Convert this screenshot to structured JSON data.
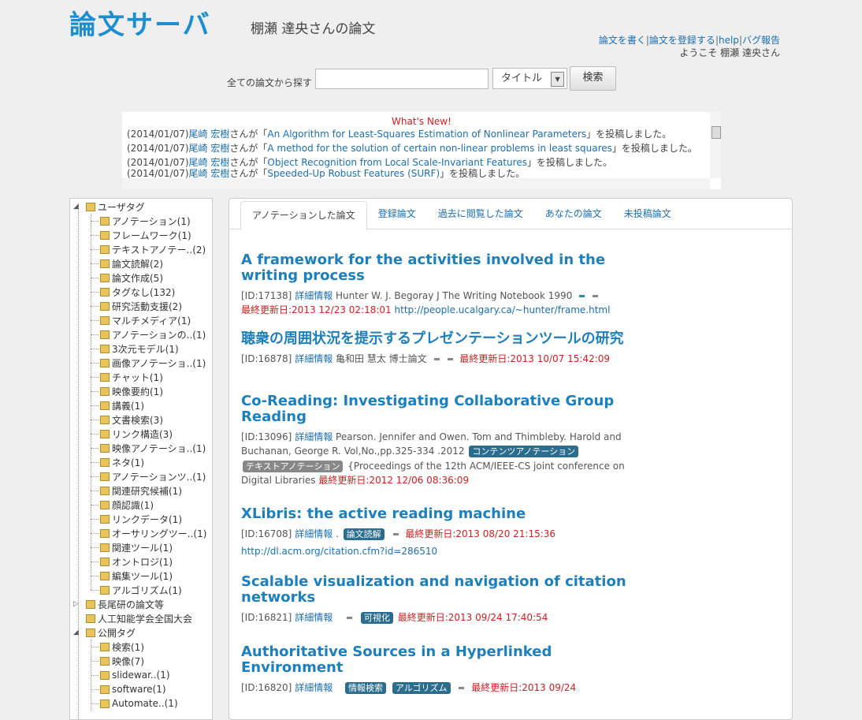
{
  "header": {
    "site_title": "論文サーバ",
    "user_heading": "棚瀬 達央さんの論文",
    "links": [
      "論文を書く",
      "論文を登録する",
      "help",
      "バグ報告"
    ],
    "welcome": "ようこそ 棚瀬 達央さん"
  },
  "search": {
    "label": "全ての論文から探す",
    "value": "",
    "field_selected": "タイトル",
    "button": "検索"
  },
  "news": {
    "title": "What's New!",
    "items": [
      {
        "date": "(2014/01/07)",
        "user": "尾崎 宏樹",
        "mid": "さんが「",
        "paper": "An Algorithm for Least-Squares Estimation of Nonlinear Parameters",
        "end": "」を投稿しました。"
      },
      {
        "date": "(2014/01/07)",
        "user": "尾崎 宏樹",
        "mid": "さんが「",
        "paper": "A method for the solution of certain non-linear problems in least squares",
        "end": "」を投稿しました。"
      },
      {
        "date": "(2014/01/07)",
        "user": "尾崎 宏樹",
        "mid": "さんが「",
        "paper": "Object Recognition from Local Scale-Invariant Features",
        "end": "」を投稿しました。"
      },
      {
        "date": "(2014/01/07)",
        "user": "尾崎 宏樹",
        "mid": "さんが「",
        "paper": "Speeded-Up Robust Features (SURF)",
        "end": "」を投稿しました。"
      }
    ]
  },
  "tree": {
    "user_tags": "ユーザタグ",
    "user_tag_items": [
      "アノテーション(1)",
      "フレームワーク(1)",
      "テキストアノテー..(2)",
      "論文読解(2)",
      "論文作成(5)",
      "タグなし(132)",
      "研究活動支援(2)",
      "マルチメディア(1)",
      "アノテーションの..(1)",
      "3次元モデル(1)",
      "画像アノテーショ..(1)",
      "チャット(1)",
      "映像要約(1)",
      "講義(1)",
      "文書検索(3)",
      "リンク構造(3)",
      "映像アノテーショ..(1)",
      "ネタ(1)",
      "アノテーションツ..(1)",
      "関連研究候補(1)",
      "顔認識(1)",
      "リンクデータ(1)",
      "オーサリングツー..(1)",
      "関連ツール(1)",
      "オントロジ(1)",
      "編集ツール(1)",
      "アルゴリズム(1)"
    ],
    "group1": "長尾研の論文等",
    "group2": "人工知能学会全国大会",
    "public_tags": "公開タグ",
    "public_tag_items": [
      "検索(1)",
      "映像(7)",
      "slidewar..(1)",
      "software(1)",
      "Automate..(1)"
    ]
  },
  "tabs": [
    "アノテーションした論文",
    "登録論文",
    "過去に閲覧した論文",
    "あなたの論文",
    "未投稿論文"
  ],
  "papers": [
    {
      "title": "A framework for the activities involved in the writing process",
      "id": "[ID:17138]",
      "detail": "詳細情報",
      "info": "Hunter W. J. Begoray J The Writing Notebook  1990",
      "upd": "最終更新日:2013 12/23 02:18:01",
      "url": "http://people.ucalgary.ca/~hunter/frame.html"
    },
    {
      "title": "聴衆の周囲状況を提示するプレゼンテーションツールの研究",
      "id": "[ID:16878]",
      "detail": "詳細情報",
      "info": "亀和田 慧太 博士論文",
      "upd": "最終更新日:2013 10/07 15:42:09"
    },
    {
      "title": "Co-Reading: Investigating Collaborative Group Reading",
      "id": "[ID:13096]",
      "detail": "詳細情報",
      "info": "Pearson. Jennifer and Owen. Tom and Thimbleby. Harold and Buchanan, George R. Vol,No.,pp.325-334 .2012",
      "badge1": "コンテンツアノテーション",
      "badge2": "テキストアノテーション",
      "info2": "{Proceedings of the 12th ACM/IEEE-CS joint conference on Digital Libraries",
      "upd": "最終更新日:2012 12/06 08:36:09"
    },
    {
      "title": "XLibris: the active reading machine",
      "id": "[ID:16708]",
      "detail": "詳細情報",
      "info": ".",
      "badge1": "論文読解",
      "upd": "最終更新日:2013 08/20 21:15:36",
      "url": "http://dl.acm.org/citation.cfm?id=286510"
    },
    {
      "title": "Scalable visualization and navigation of citation networks",
      "id": "[ID:16821]",
      "detail": "詳細情報",
      "badge1": "可視化",
      "upd": "最終更新日:2013 09/24 17:40:54"
    },
    {
      "title": "Authoritative Sources in a Hyperlinked Environment",
      "id": "[ID:16820]",
      "detail": "詳細情報",
      "badge1": "情報検索",
      "badge2": "アルゴリズム",
      "upd": "最終更新日:2013 09/24"
    }
  ]
}
